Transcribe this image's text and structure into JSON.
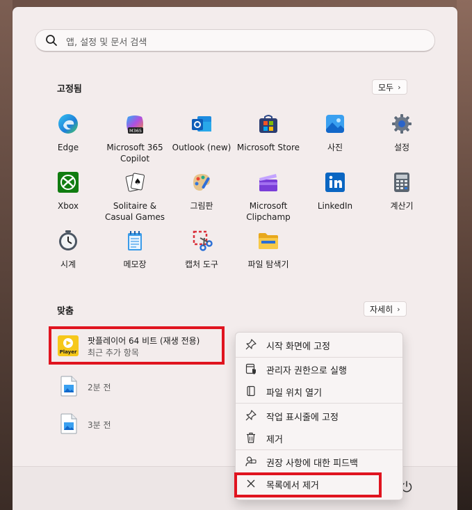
{
  "search": {
    "placeholder": "앱, 설정 및 문서 검색"
  },
  "pinned": {
    "title": "고정됨",
    "all_button": "모두",
    "apps": [
      {
        "label": "Edge",
        "icon": "edge-icon"
      },
      {
        "label": "Microsoft 365 Copilot",
        "icon": "m365-copilot-icon",
        "badge": "M365"
      },
      {
        "label": "Outlook (new)",
        "icon": "outlook-icon"
      },
      {
        "label": "Microsoft Store",
        "icon": "store-icon"
      },
      {
        "label": "사진",
        "icon": "photos-icon"
      },
      {
        "label": "설정",
        "icon": "gear-icon"
      },
      {
        "label": "Xbox",
        "icon": "xbox-icon"
      },
      {
        "label": "Solitaire & Casual Games",
        "icon": "solitaire-icon"
      },
      {
        "label": "그림판",
        "icon": "paint-icon"
      },
      {
        "label": "Microsoft Clipchamp",
        "icon": "clipchamp-icon"
      },
      {
        "label": "LinkedIn",
        "icon": "linkedin-icon"
      },
      {
        "label": "계산기",
        "icon": "calculator-icon"
      },
      {
        "label": "시계",
        "icon": "clock-icon"
      },
      {
        "label": "메모장",
        "icon": "notepad-icon"
      },
      {
        "label": "캡처 도구",
        "icon": "snipping-tool-icon"
      },
      {
        "label": "파일 탐색기",
        "icon": "file-explorer-icon"
      }
    ]
  },
  "recommended": {
    "title": "맞춤",
    "more_button": "자세히",
    "items": [
      {
        "title": "팟플레이어 64 비트 (재생 전용)",
        "subtitle": "최근 추가 항목",
        "icon": "potplayer-icon",
        "icon_text": "Player"
      },
      {
        "title": "",
        "subtitle": "2분 전",
        "icon": "image-file-icon"
      },
      {
        "title": "",
        "subtitle": "3분 전",
        "icon": "image-file-icon"
      }
    ]
  },
  "context_menu": {
    "items": [
      {
        "label": "시작 화면에 고정",
        "icon": "pin-icon"
      },
      {
        "label": "관리자 권한으로 실행",
        "icon": "admin-shield-icon"
      },
      {
        "label": "파일 위치 열기",
        "icon": "folder-icon"
      },
      {
        "label": "작업 표시줄에 고정",
        "icon": "pin-icon"
      },
      {
        "label": "제거",
        "icon": "trash-icon"
      },
      {
        "label": "권장 사항에 대한 피드백",
        "icon": "feedback-icon"
      },
      {
        "label": "목록에서 제거",
        "icon": "close-icon"
      }
    ]
  },
  "colors": {
    "highlight": "#e0141f",
    "panel": "#f3ecec"
  }
}
